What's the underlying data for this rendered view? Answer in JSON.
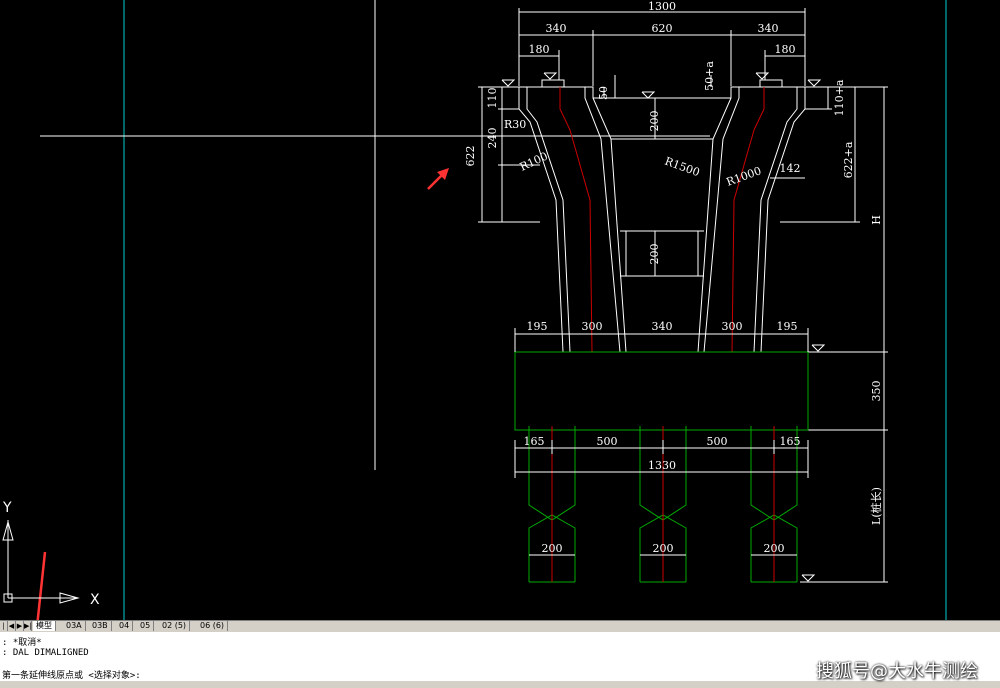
{
  "drawing": {
    "dims": {
      "total_top": "1300",
      "seg_left": "340",
      "seg_mid": "620",
      "seg_right": "340",
      "edge_left": "180",
      "edge_right": "180",
      "d110": "110",
      "d50": "50",
      "d50a": "50+a",
      "d110a": "110+a",
      "d200_top": "200",
      "d240": "240",
      "r30": "R30",
      "d622": "622",
      "r100": "R100",
      "r1500": "R1500",
      "r1000": "R1000",
      "d142": "142",
      "d622a": "622+a",
      "h_label": "H",
      "d200_mid": "200",
      "b195_l": "195",
      "b300_l": "300",
      "b340": "340",
      "b300_r": "300",
      "b195_r": "195",
      "d350": "350",
      "p165_l": "165",
      "p500_l": "500",
      "p500_r": "500",
      "p165_r": "165",
      "total_bottom": "1330",
      "l_label": "L(桩长)",
      "pile_w1": "200",
      "pile_w2": "200",
      "pile_w3": "200"
    },
    "ucs": {
      "y": "Y",
      "x": "X"
    }
  },
  "tabs": {
    "nav": [
      "|◀",
      "◀",
      "▶",
      "▶|"
    ],
    "items": [
      {
        "label": "模型",
        "active": true
      },
      {
        "label": "03A",
        "active": false
      },
      {
        "label": "03B",
        "active": false
      },
      {
        "label": "04",
        "active": false
      },
      {
        "label": "05",
        "active": false
      },
      {
        "label": "02 (5)",
        "active": false
      },
      {
        "label": "06 (6)",
        "active": false
      }
    ]
  },
  "command": {
    "line1": ": *取消*",
    "line2": ": DAL DIMALIGNED",
    "line3": "第一条延伸线原点或 <选择对象>:"
  },
  "watermark": "搜狐号@大水牛测绘",
  "colors": {
    "canvas": "#000000",
    "line": "#ffffff",
    "cap": "#00aa00",
    "center": "#cc0000",
    "cyan": "#00cccc",
    "arrow": "#ff3333"
  }
}
